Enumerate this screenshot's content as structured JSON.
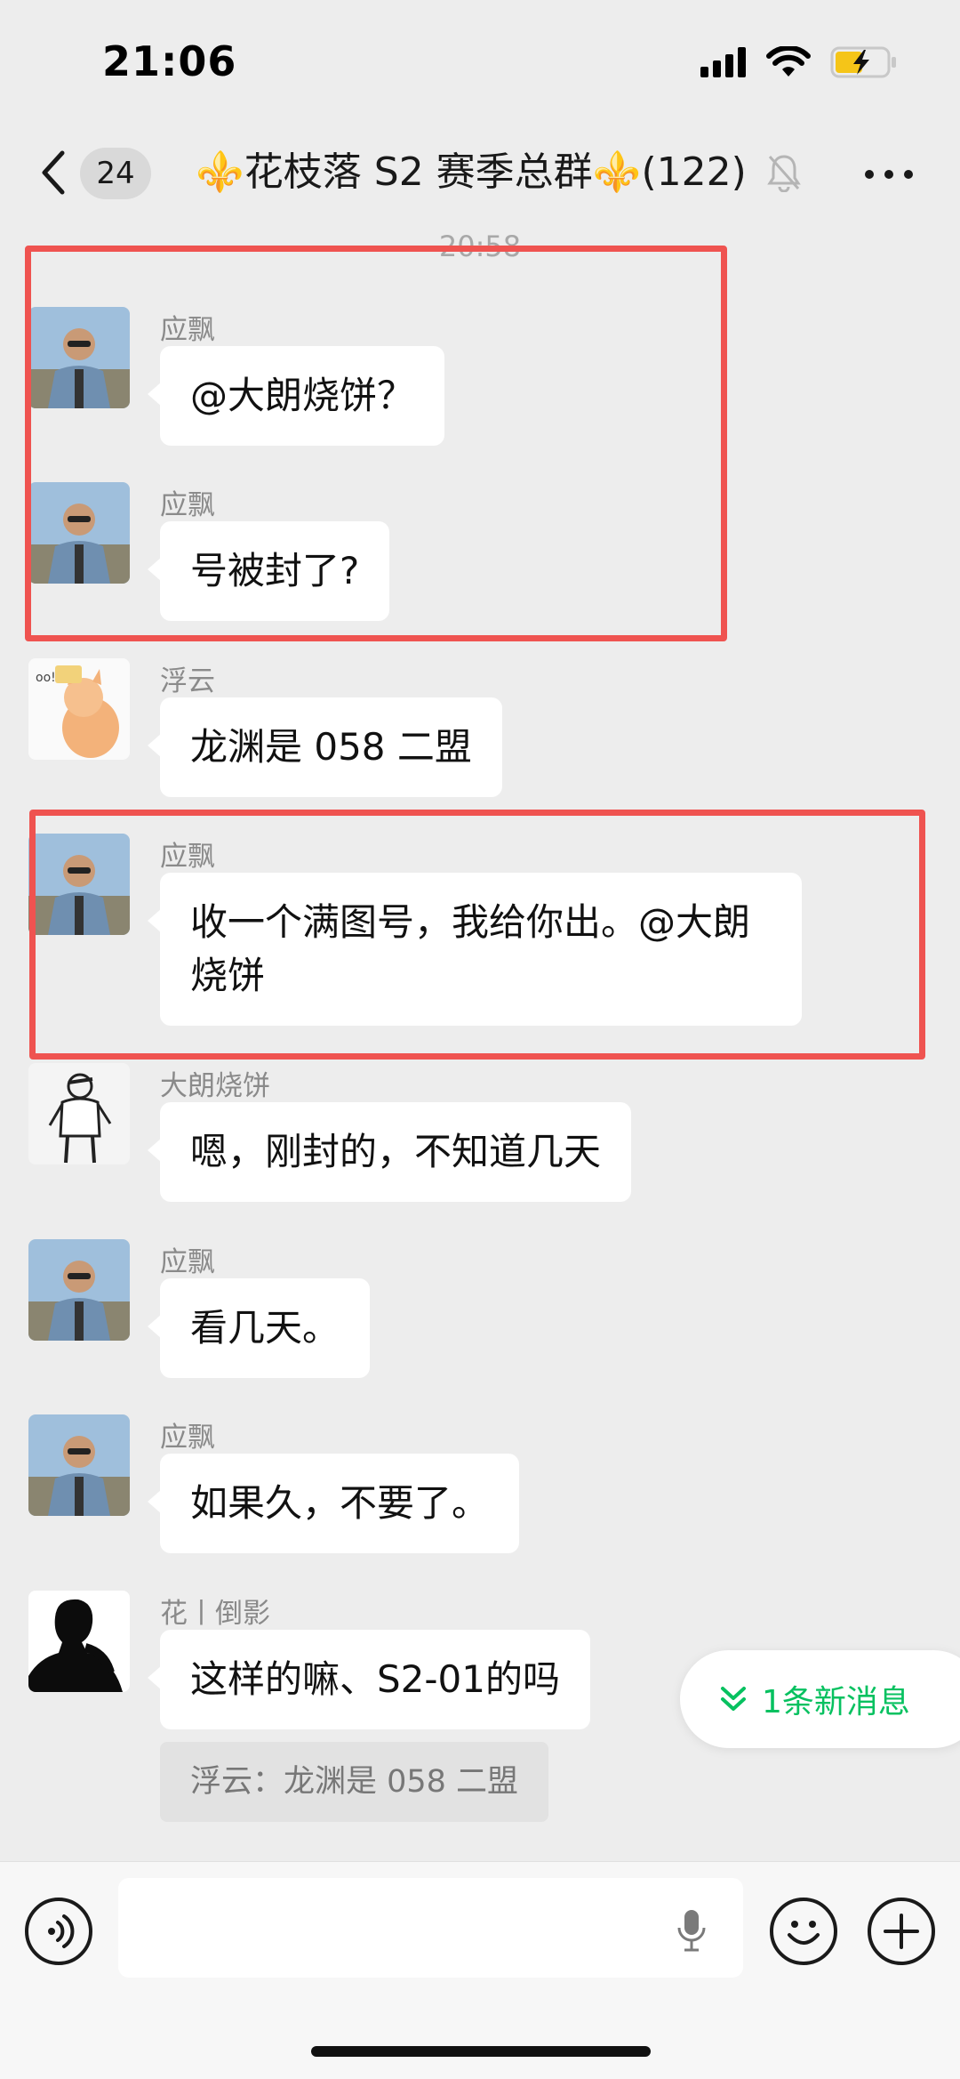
{
  "status_bar": {
    "time": "21:06"
  },
  "nav": {
    "unread_count": "24",
    "title": "⚜️花枝落 S2 赛季总群⚜️(122)"
  },
  "timestamp": "20:58",
  "messages": [
    {
      "sender": "应飘",
      "text": "@大朗烧饼？",
      "avatar": "person-sunglasses-avatar"
    },
    {
      "sender": "应飘",
      "text": "号被封了?",
      "avatar": "person-sunglasses-avatar"
    },
    {
      "sender": "浮云",
      "text": "龙渊是 058 二盟",
      "avatar": "cartoon-cat-avatar"
    },
    {
      "sender": "应飘",
      "text": "收一个满图号，我给你出。@大朗烧饼",
      "avatar": "person-sunglasses-avatar"
    },
    {
      "sender": "大朗烧饼",
      "text": "嗯，刚封的，不知道几天",
      "avatar": "sketch-man-avatar"
    },
    {
      "sender": "应飘",
      "text": "看几天。",
      "avatar": "person-sunglasses-avatar"
    },
    {
      "sender": "应飘",
      "text": "如果久，不要了。",
      "avatar": "person-sunglasses-avatar"
    },
    {
      "sender": "花丨倒影",
      "text": "这样的嘛、S2-01的吗",
      "avatar": "silhouette-avatar",
      "quote": "浮云：龙渊是 058 二盟"
    }
  ],
  "new_message_pill": {
    "label": "1条新消息"
  },
  "colors": {
    "background": "#ededed",
    "bubble": "#ffffff",
    "highlight_box": "#ef5350",
    "accent_green": "#07c160"
  }
}
